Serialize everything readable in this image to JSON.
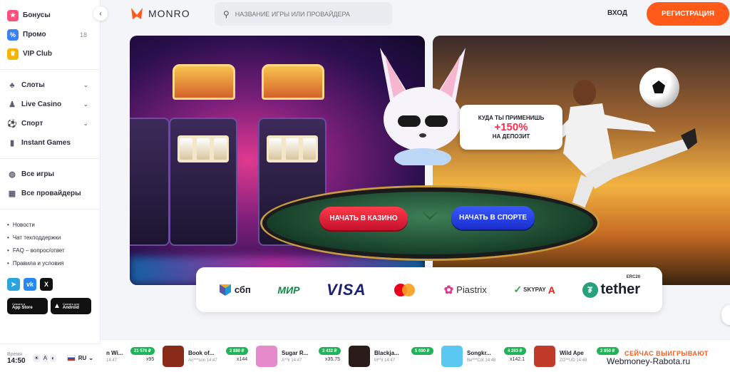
{
  "sidebar": {
    "top_items": [
      {
        "label": "Бонусы",
        "icon": "bonus-icon",
        "color": "#ff4f7b"
      },
      {
        "label": "Промо",
        "icon": "promo-icon",
        "color": "#3b82f6",
        "count": "18"
      },
      {
        "label": "VIP Club",
        "icon": "crown-icon",
        "color": "#f5b400"
      }
    ],
    "nav_items": [
      {
        "label": "Слоты",
        "icon": "slots-icon"
      },
      {
        "label": "Live Casino",
        "icon": "live-casino-icon"
      },
      {
        "label": "Спорт",
        "icon": "sport-icon"
      },
      {
        "label": "Instant Games",
        "icon": "instant-games-icon"
      }
    ],
    "catalog_items": [
      {
        "label": "Все игры",
        "icon": "all-games-icon"
      },
      {
        "label": "Все провайдеры",
        "icon": "providers-icon"
      }
    ],
    "links": [
      "Новости",
      "Чат техподдержки",
      "FAQ – вопрос/ответ",
      "Правила и условия"
    ],
    "socials": [
      {
        "name": "telegram-icon",
        "glyph": "➤",
        "color": "#2aa3df"
      },
      {
        "name": "vk-icon",
        "glyph": "vk",
        "color": "#2787f5"
      },
      {
        "name": "x-icon",
        "glyph": "X",
        "color": "#111111"
      }
    ],
    "stores": [
      {
        "small": "Скачать в",
        "big": "App Store",
        "icon": "apple-icon",
        "glyph": ""
      },
      {
        "small": "Скачать для",
        "big": "Android",
        "icon": "android-icon",
        "glyph": "▲"
      }
    ],
    "time_label": "Время",
    "time_value": "14:50",
    "accessibility": [
      "☀",
      "A",
      "◐"
    ],
    "language": "RU"
  },
  "header": {
    "brand": "MONRO",
    "search_placeholder": "НАЗВАНИЕ ИГРЫ ИЛИ ПРОВАЙДЕРА",
    "login_label": "ВХОД",
    "register_label": "РЕГИСТРАЦИЯ"
  },
  "hero": {
    "promo_line1": "КУДА ТЫ ПРИМЕНИШЬ",
    "promo_big": "+150%",
    "promo_line3": "НА ДЕПОЗИТ",
    "casino_button": "НАЧАТЬ В КАЗИНО",
    "sport_button": "НАЧАТЬ В СПОРТЕ"
  },
  "payments": {
    "sbp": "сбп",
    "mir": "МИР",
    "visa": "VISA",
    "piastrix": "Piastrix",
    "skypay": "SKYPAY",
    "tether": "tether",
    "tether_tag": "ERC20"
  },
  "wins": [
    {
      "game": "n Wi...",
      "amount": "21 576 ₽",
      "user": "",
      "time": "14:47",
      "mult": "x95",
      "thumb": "#7b3fa0"
    },
    {
      "game": "Book of...",
      "amount": "2 880 ₽",
      "user": "An***son",
      "time": "14:47",
      "mult": "x144",
      "thumb": "#8a2b1a"
    },
    {
      "game": "Sugar R...",
      "amount": "3 432 ₽",
      "user": "A**k",
      "time": "14:47",
      "mult": "x35.75",
      "thumb": "#e58acb"
    },
    {
      "game": "Blackja...",
      "amount": "5 690 ₽",
      "user": "M**il",
      "time": "14:47",
      "mult": "",
      "thumb": "#2a1c1a"
    },
    {
      "game": "Songkr...",
      "amount": "4 263 ₽",
      "user": "Be***Cot",
      "time": "14:48",
      "mult": "x142.1",
      "thumb": "#5ac8f0"
    },
    {
      "game": "Wild Ape",
      "amount": "2 850 ₽",
      "user": "ZO**UD",
      "time": "14:48",
      "mult": "x1",
      "thumb": "#c23a2a"
    }
  ],
  "now_winning": "СЕЙЧАС ВЫИГРЫВАЮТ",
  "watermark": "Webmoney-Rabota.ru",
  "colors": {
    "accent": "#ff5a1a",
    "win_badge": "#1fb457",
    "casino": "#e0192f",
    "sport": "#2a44ee"
  }
}
